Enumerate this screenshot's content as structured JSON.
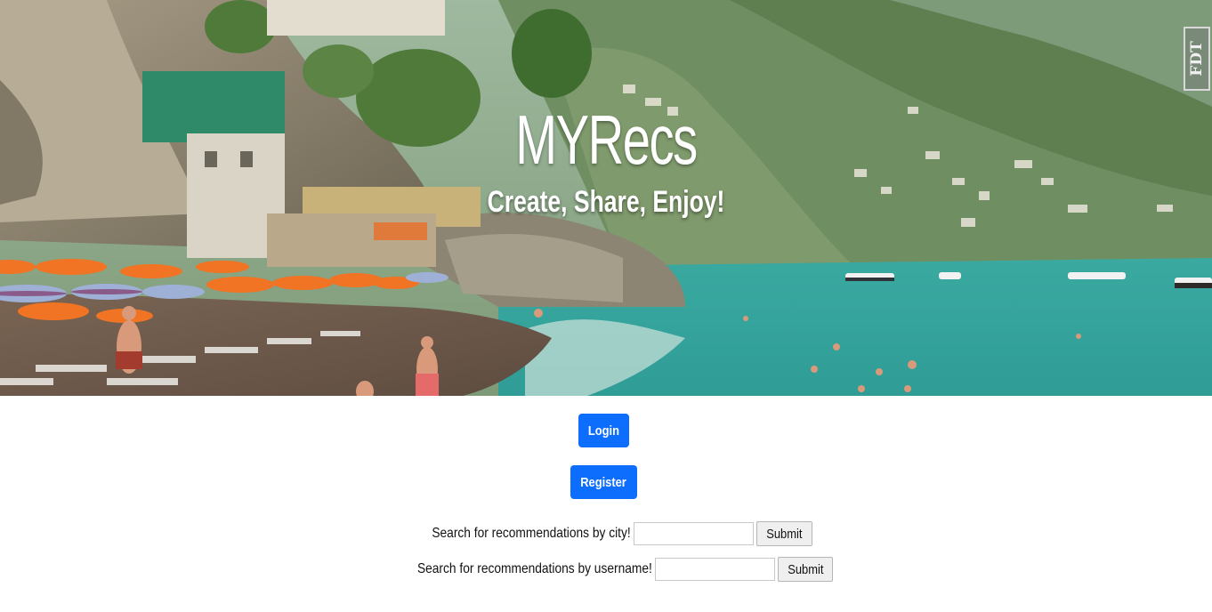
{
  "hero": {
    "title": "MYRecs",
    "subtitle": "Create, Share, Enjoy!",
    "background_image": "beach-cliff-coastal-town",
    "watermark_text": "FDT"
  },
  "auth": {
    "login_label": "Login",
    "register_label": "Register"
  },
  "search": {
    "city": {
      "label": "Search for recommendations by city!",
      "value": "",
      "submit_label": "Submit"
    },
    "username": {
      "label": "Search for recommendations by username!",
      "value": "",
      "submit_label": "Submit"
    }
  },
  "colors": {
    "primary_button": "#0d6efd",
    "hero_text": "#ffffff"
  }
}
